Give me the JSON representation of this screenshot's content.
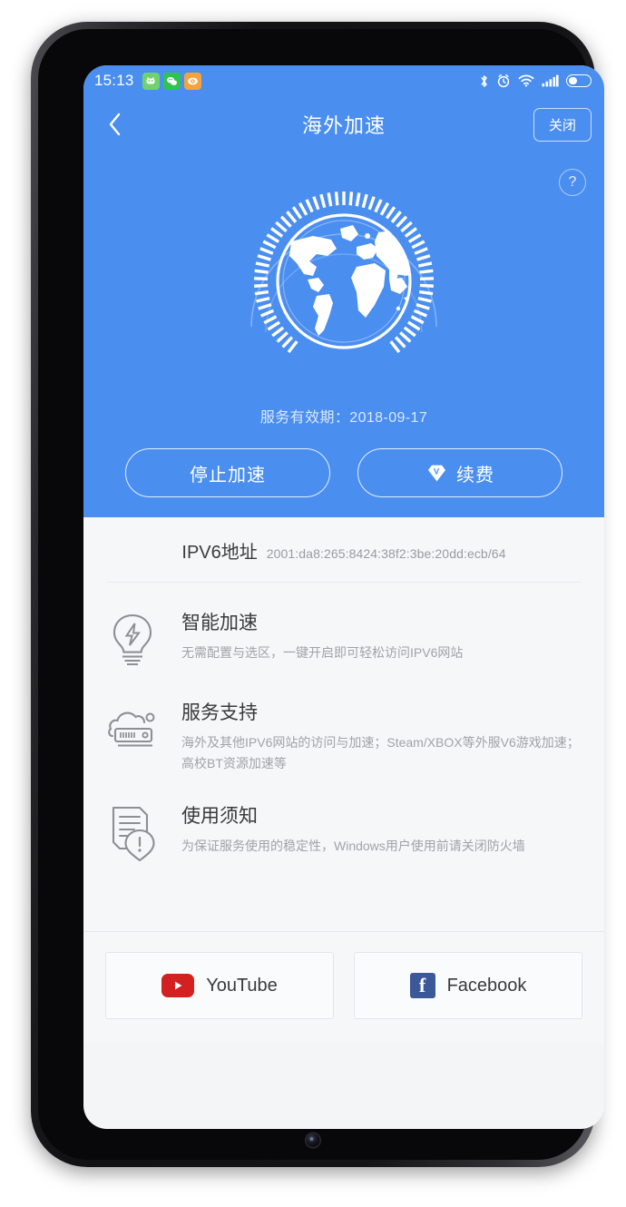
{
  "statusbar": {
    "clock": "15:13",
    "notifications": [
      {
        "name": "android-app-icon",
        "glyph": "☻"
      },
      {
        "name": "wechat-icon",
        "glyph": "❁"
      },
      {
        "name": "weibo-icon",
        "glyph": "◉"
      }
    ],
    "icons": [
      "bluetooth-icon",
      "alarm-icon",
      "wifi-icon",
      "cellular-signal-icon",
      "battery-icon"
    ]
  },
  "header": {
    "title": "海外加速",
    "back_label": "‹",
    "close_label": "关闭"
  },
  "hero": {
    "help_label": "?",
    "expiry_text": "服务有效期：2018-09-17",
    "stop_button_label": "停止加速",
    "renew_button_label": "续费"
  },
  "ipv6": {
    "label": "IPV6地址",
    "value": "2001:da8:265:8424:38f2:3be:20dd:ecb/64"
  },
  "features": [
    {
      "icon": "lightbulb-icon",
      "title": "智能加速",
      "desc": "无需配置与选区，一键开启即可轻松访问IPV6网站"
    },
    {
      "icon": "cloud-server-icon",
      "title": "服务支持",
      "desc": "海外及其他IPV6网站的访问与加速；Steam/XBOX等外服V6游戏加速；高校BT资源加速等"
    },
    {
      "icon": "document-alert-icon",
      "title": "使用须知",
      "desc": "为保证服务使用的稳定性，Windows用户使用前请关闭防火墙"
    }
  ],
  "social": [
    {
      "name": "youtube-button",
      "label": "YouTube",
      "color": "#d32020"
    },
    {
      "name": "facebook-button",
      "label": "Facebook",
      "color": "#3b5998"
    }
  ],
  "colors": {
    "brand_blue": "#4a8ef0",
    "content_bg": "#f6f7f9",
    "divider": "#e6e8ec"
  }
}
